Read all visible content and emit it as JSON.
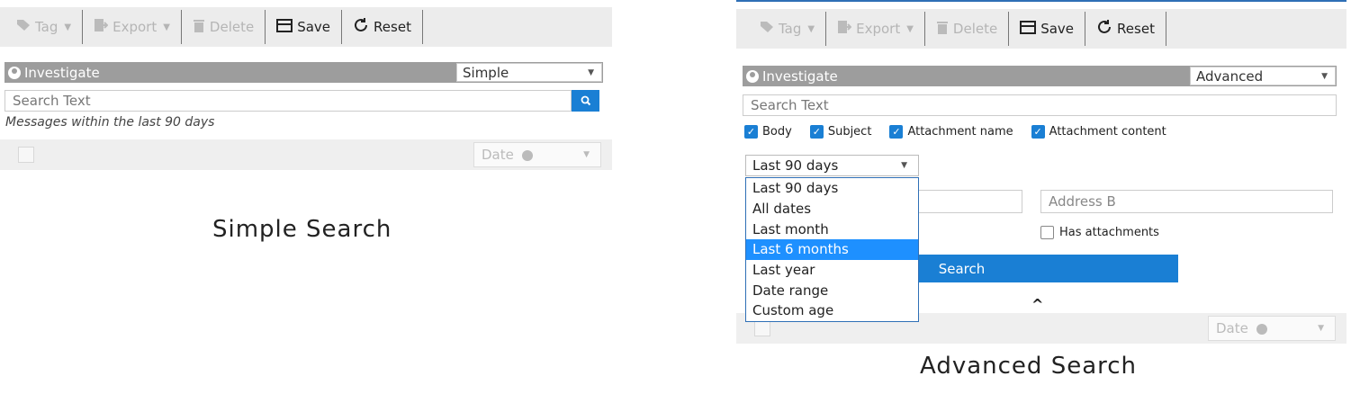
{
  "toolbar": {
    "tag": "Tag",
    "export": "Export",
    "delete": "Delete",
    "save": "Save",
    "reset": "Reset"
  },
  "simple": {
    "investigate_label": "Investigate",
    "mode": "Simple",
    "search_placeholder": "Search Text",
    "hint": "Messages within the last 90 days",
    "sort_label": "Date",
    "caption": "Simple Search"
  },
  "advanced": {
    "investigate_label": "Investigate",
    "mode": "Advanced",
    "search_placeholder": "Search Text",
    "checkboxes": [
      {
        "label": "Body",
        "checked": true
      },
      {
        "label": "Subject",
        "checked": true
      },
      {
        "label": "Attachment name",
        "checked": true
      },
      {
        "label": "Attachment content",
        "checked": true
      }
    ],
    "date_selected": "Last 90 days",
    "date_options": [
      "Last 90 days",
      "All dates",
      "Last month",
      "Last 6 months",
      "Last year",
      "Date range",
      "Custom age"
    ],
    "date_highlighted": "Last 6 months",
    "address_b_placeholder": "Address B",
    "has_attachments": "Has attachments",
    "search_button": "Search",
    "sort_label": "Date",
    "caption": "Advanced Search"
  },
  "colors": {
    "accent": "#1a7fd4",
    "highlight": "#1e90ff",
    "investigate_bar": "#9d9d9d",
    "toolbar_bg": "#ececec"
  },
  "icons": [
    "tag-icon",
    "export-icon",
    "trash-icon",
    "save-icon",
    "reset-icon",
    "person-icon",
    "search-icon",
    "chevron-up-icon",
    "sort-icon"
  ]
}
